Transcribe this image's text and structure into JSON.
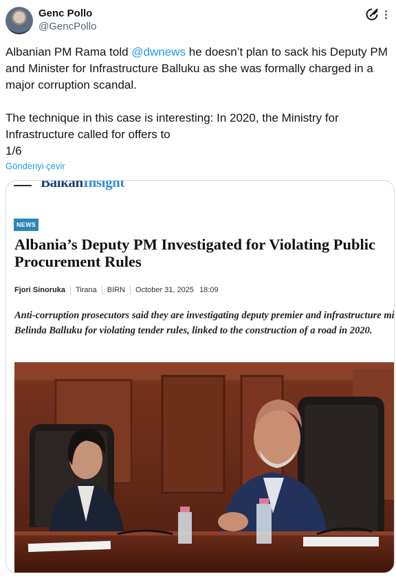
{
  "tweet": {
    "author": {
      "display_name": "Genc Pollo",
      "handle": "@GencPollo"
    },
    "text": {
      "p1_before": "Albanian PM Rama told ",
      "mention": "@dwnews",
      "p1_after": " he doesn’t plan to sack his Deputy PM and Minister for Infrastructure Balluku as she was formally charged in a major corruption scandal.",
      "p2": "The technique in this case is interesting: In 2020, the Ministry for Infrastructure called for offers to",
      "thread_count": "1/6"
    },
    "translate_label": "Gönderiyi çevir",
    "accent_color": "#1d9bf0"
  },
  "article_card": {
    "brand_prefix": "Balkan",
    "brand_suffix": "Insight",
    "badge": "NEWS",
    "headline": "Albania’s Deputy PM Investigated for Violating Public Procurement Rules",
    "byline": {
      "author": "Fjori Sinoruka",
      "location": "Tirana",
      "outlet": "BIRN",
      "date": "October 31, 2025",
      "time": "18:09"
    },
    "lede": "Anti-corruption prosecutors said they are investigating deputy premier and infrastructure minister Belinda Balluku for violating tender rules, linked to the construction of a road in 2020.",
    "photo_description_icon": "parliament-photo"
  }
}
